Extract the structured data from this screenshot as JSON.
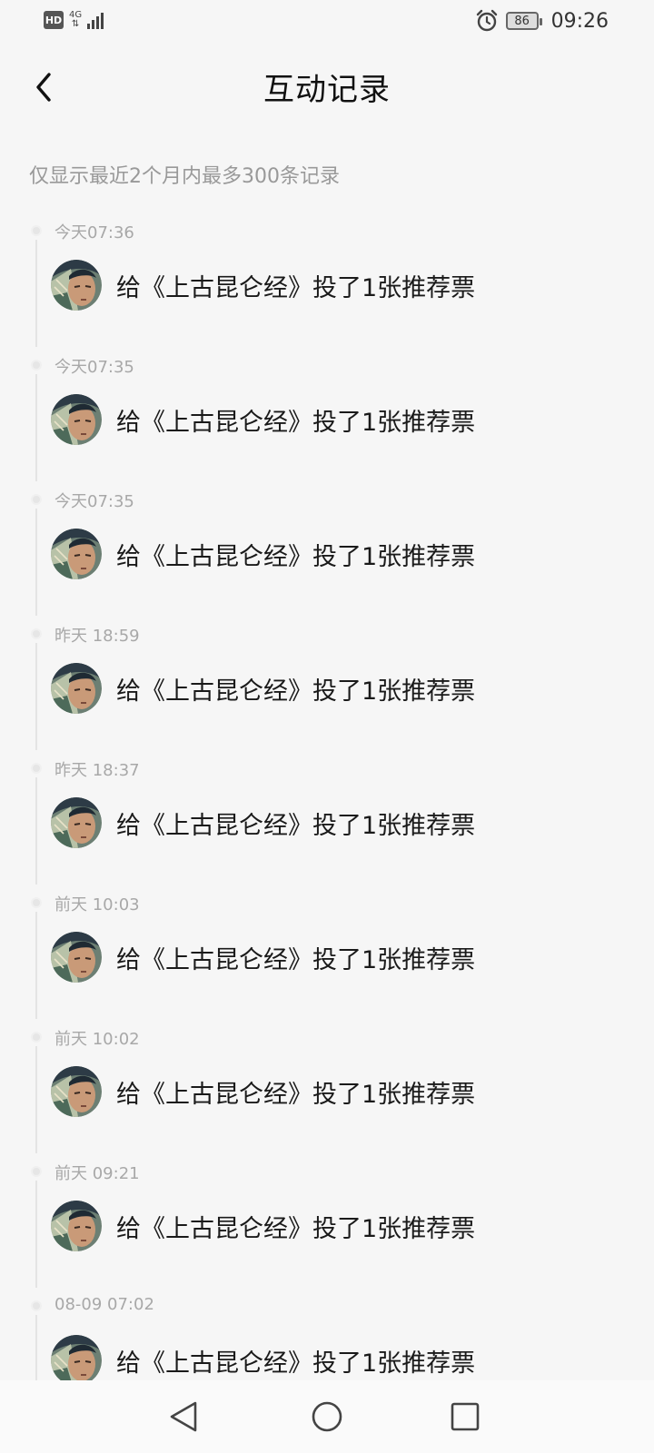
{
  "status_bar": {
    "hd_label": "HD",
    "network_label": "4G",
    "battery_level": "86",
    "time": "09:26"
  },
  "header": {
    "title": "互动记录"
  },
  "notice": "仅显示最近2个月内最多300条记录",
  "records": [
    {
      "time": "今天07:36",
      "text": "给《上古昆仑经》投了1张推荐票"
    },
    {
      "time": "今天07:35",
      "text": "给《上古昆仑经》投了1张推荐票"
    },
    {
      "time": "今天07:35",
      "text": "给《上古昆仑经》投了1张推荐票"
    },
    {
      "time": "昨天 18:59",
      "text": "给《上古昆仑经》投了1张推荐票"
    },
    {
      "time": "昨天 18:37",
      "text": "给《上古昆仑经》投了1张推荐票"
    },
    {
      "time": "前天 10:03",
      "text": "给《上古昆仑经》投了1张推荐票"
    },
    {
      "time": "前天 10:02",
      "text": "给《上古昆仑经》投了1张推荐票"
    },
    {
      "time": "前天 09:21",
      "text": "给《上古昆仑经》投了1张推荐票"
    },
    {
      "time": "08-09 07:02",
      "text": "给《上古昆仑经》投了1张推荐票"
    }
  ]
}
